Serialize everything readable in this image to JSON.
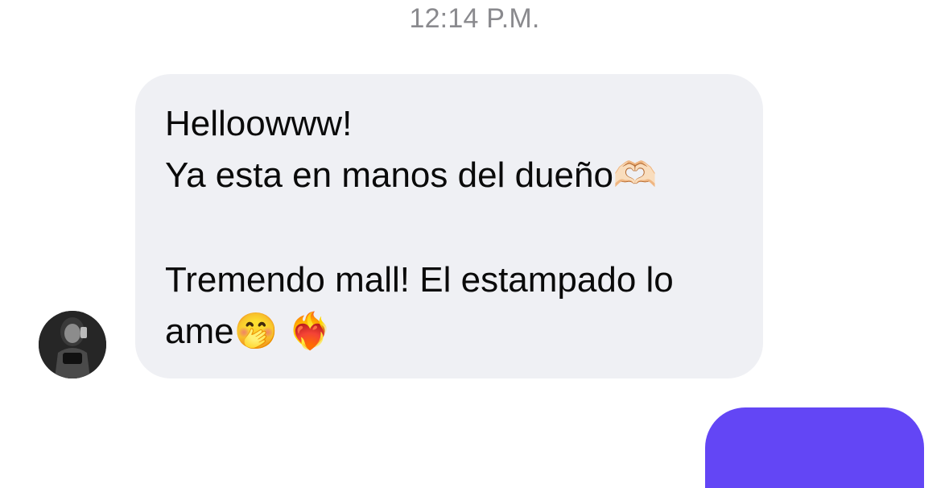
{
  "timestamp": "12:14 P.M.",
  "message": {
    "lines": [
      "Helloowww!",
      "Ya esta en manos del dueño🫶🏻",
      "",
      "Tremendo mall! El estampado lo",
      "ame🤭 ❤️‍🔥"
    ]
  },
  "colors": {
    "received_bubble": "#eff0f4",
    "sent_bubble": "#6346f5",
    "timestamp_text": "#8a8a8e"
  }
}
